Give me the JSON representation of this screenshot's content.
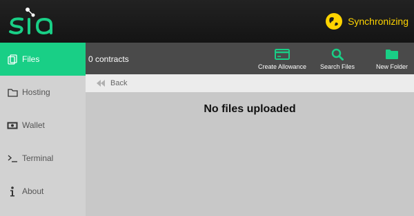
{
  "app": {
    "logo_text": "sia"
  },
  "status": {
    "text": "Synchronizing",
    "icon": "globe-icon"
  },
  "sidebar": {
    "items": [
      {
        "label": "Files",
        "icon": "files-icon",
        "active": true
      },
      {
        "label": "Hosting",
        "icon": "folder-icon",
        "active": false
      },
      {
        "label": "Wallet",
        "icon": "wallet-icon",
        "active": false
      },
      {
        "label": "Terminal",
        "icon": "terminal-icon",
        "active": false
      },
      {
        "label": "About",
        "icon": "info-icon",
        "active": false
      }
    ]
  },
  "toolbar": {
    "contracts": "0 contracts",
    "create_allowance": "Create Allowance",
    "search_files": "Search Files",
    "new_folder": "New Folder"
  },
  "nav": {
    "back": "Back"
  },
  "content": {
    "empty_message": "No files uploaded"
  },
  "colors": {
    "accent": "#19cf86",
    "sync": "#ffd400"
  }
}
